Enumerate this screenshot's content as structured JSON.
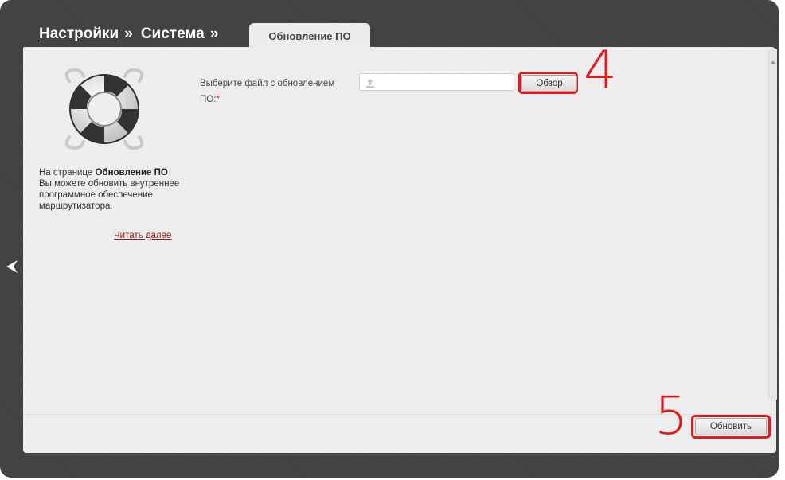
{
  "breadcrumb": {
    "items": [
      {
        "label": "Настройки"
      },
      {
        "label": "Система"
      }
    ],
    "separator": "»"
  },
  "active_tab": {
    "label": "Обновление ПО"
  },
  "sidebar": {
    "icon": "lifebuoy-icon",
    "description_prefix": "На странице ",
    "description_bold": "Обновление ПО",
    "description_suffix": " Вы можете обновить внутреннее программное обеспечение маршрутизатора.",
    "read_more": "Читать далее"
  },
  "form": {
    "file_label": "Выберите файл с обновлением ПО:",
    "required_mark": "*",
    "file_value": "",
    "upload_icon": "upload-icon",
    "browse_button": "Обзор"
  },
  "footer": {
    "update_button": "Обновить"
  },
  "annotations": {
    "step_browse": "4",
    "step_update": "5"
  },
  "colors": {
    "frame": "#424242",
    "panel": "#efefef",
    "annotation": "#e11b1b",
    "link": "#8a1a1a",
    "required": "#d41c1c"
  }
}
